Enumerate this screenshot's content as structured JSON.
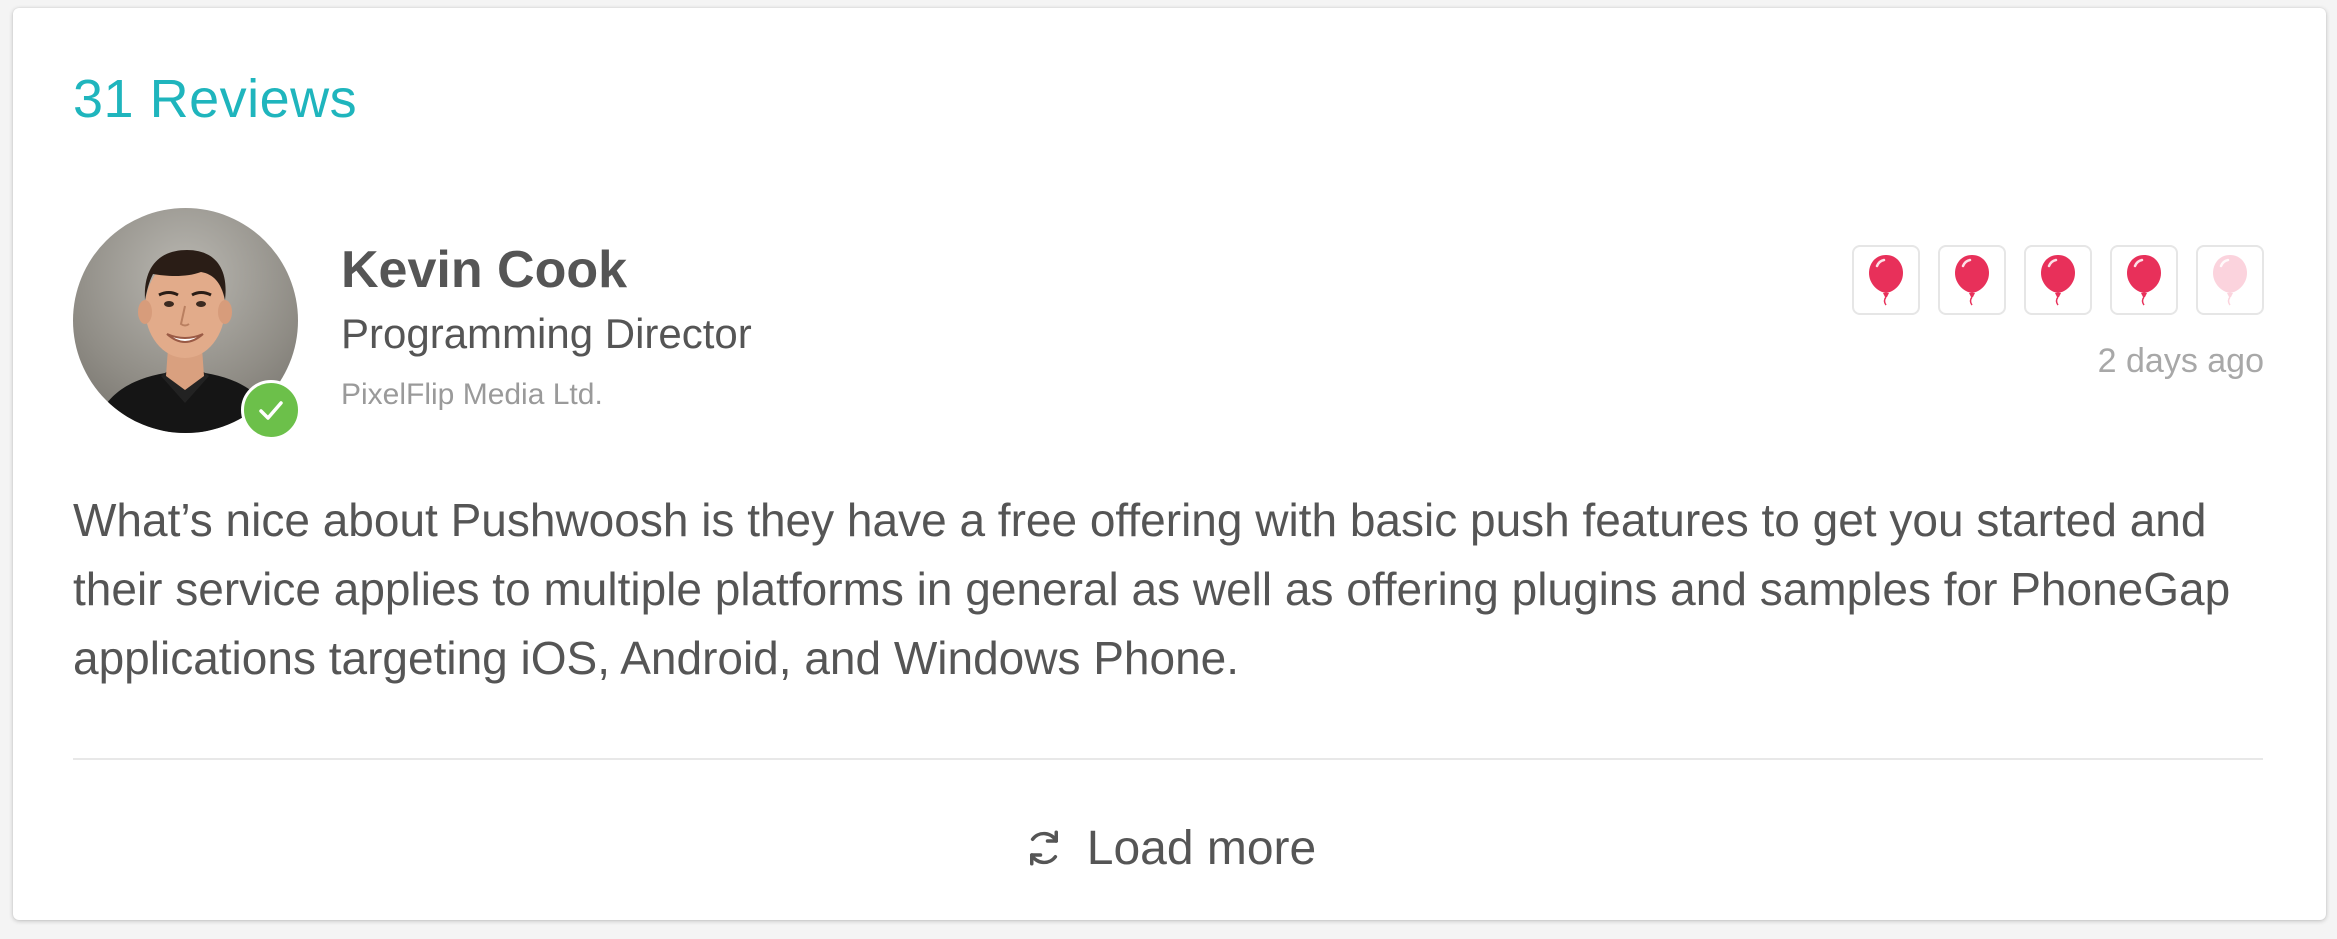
{
  "header": {
    "reviews_title": "31 Reviews"
  },
  "review": {
    "avatar_icon": "avatar",
    "verified_icon": "checkmark-icon",
    "verified_color": "#6cc04a",
    "reviewer_name": "Kevin Cook",
    "reviewer_title": "Programming Director",
    "reviewer_company": "PixelFlip Media Ltd.",
    "rating": {
      "value": 4,
      "max": 5,
      "icon": "balloon-icon",
      "filled_color": "#e8305a",
      "empty_color": "#fbd3dd"
    },
    "date": "2 days ago",
    "text": "What’s nice about Pushwoosh is they have a free offering with basic push features to get you started and their service applies to multiple platforms in general as well as offering plugins and samples for PhoneGap applications targeting iOS, Android, and Windows Phone."
  },
  "footer": {
    "load_more_label": "Load more",
    "load_more_icon": "refresh-icon"
  },
  "colors": {
    "accent": "#1fb5bd",
    "text": "#555555",
    "muted": "#9a9a9a"
  }
}
